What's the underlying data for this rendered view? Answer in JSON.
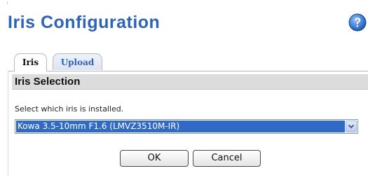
{
  "header": {
    "title": "Iris Configuration",
    "help_icon": "help-question-icon",
    "title_color": "#2f63b4"
  },
  "tabs": [
    {
      "label": "Iris",
      "active": true
    },
    {
      "label": "Upload",
      "active": false
    }
  ],
  "section": {
    "title": "Iris Selection",
    "instruction": "Select which iris is installed.",
    "iris_select": {
      "value": "Kowa 3.5-10mm F1.6 (LMVZ3510M-IR)",
      "icon": "chevron-down-icon"
    }
  },
  "actions": {
    "ok_label": "OK",
    "cancel_label": "Cancel"
  }
}
